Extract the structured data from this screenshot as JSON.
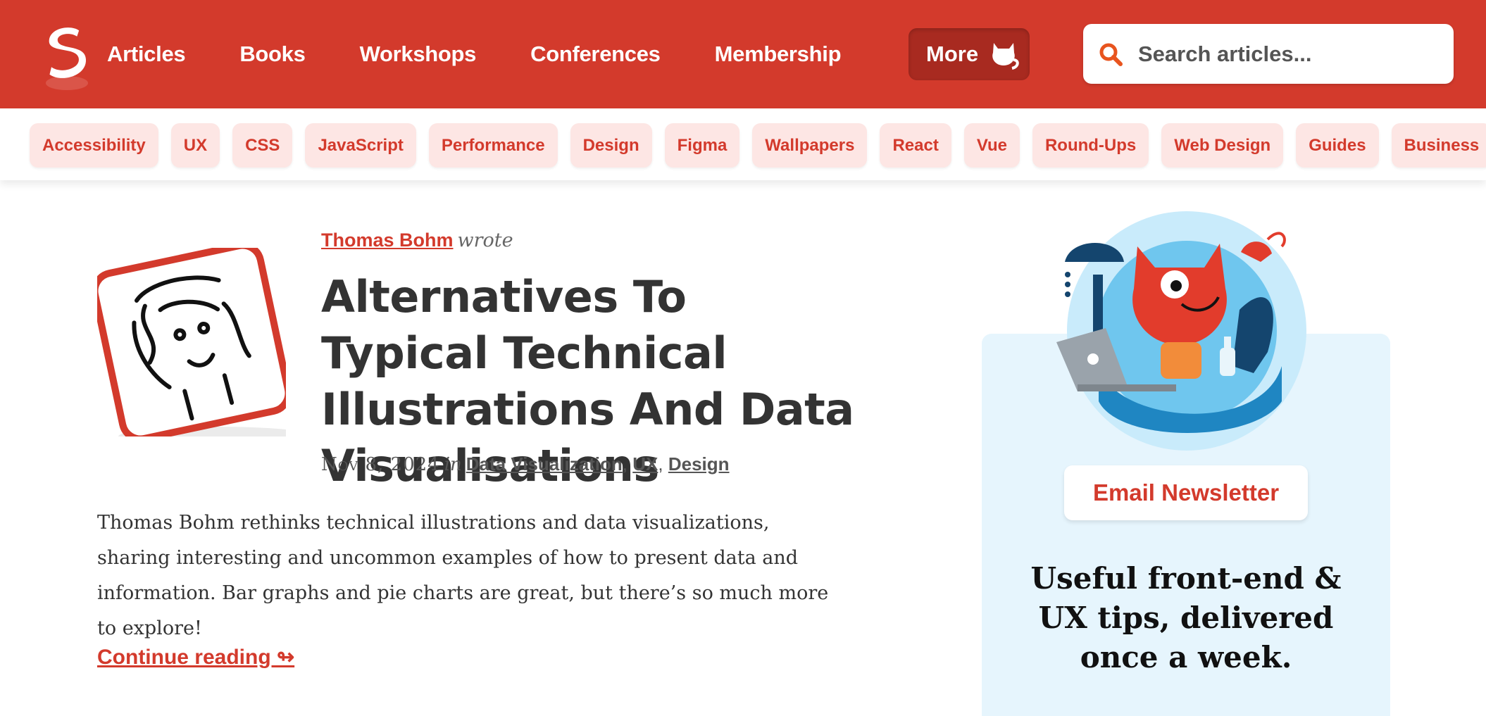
{
  "header": {
    "logo_icon": "smashing-s-logo",
    "nav": [
      {
        "label": "Articles"
      },
      {
        "label": "Books"
      },
      {
        "label": "Workshops"
      },
      {
        "label": "Conferences"
      },
      {
        "label": "Membership"
      }
    ],
    "more_label": "More",
    "search_placeholder": "Search articles..."
  },
  "tags": [
    "Accessibility",
    "UX",
    "CSS",
    "JavaScript",
    "Performance",
    "Design",
    "Figma",
    "Wallpapers",
    "React",
    "Vue",
    "Round-Ups",
    "Web Design",
    "Guides",
    "Business"
  ],
  "article": {
    "author": "Thomas Bohm",
    "wrote": "wrote",
    "title": "Alternatives To Typical Technical Illustrations And Data Visualisations",
    "date": "Nov 8, 2024",
    "in": "in",
    "categories": [
      "Data Visualization",
      "UX",
      "Design"
    ],
    "excerpt": "Thomas Bohm rethinks technical illustrations and data visualizations, sharing interesting and uncommon examples of how to present data and information. Bar graphs and pie charts are great, but there’s so much more to explore!",
    "continue_label": "Continue reading ↬"
  },
  "sidebar": {
    "newsletter_button": "Email Newsletter",
    "tips_heading": "Useful front-end & UX tips, delivered once a week."
  },
  "colors": {
    "brand_red": "#d33a2c",
    "more_button": "#a82a20",
    "tag_bg": "#fde6e4",
    "sidebar_bg": "#e6f5fd"
  }
}
